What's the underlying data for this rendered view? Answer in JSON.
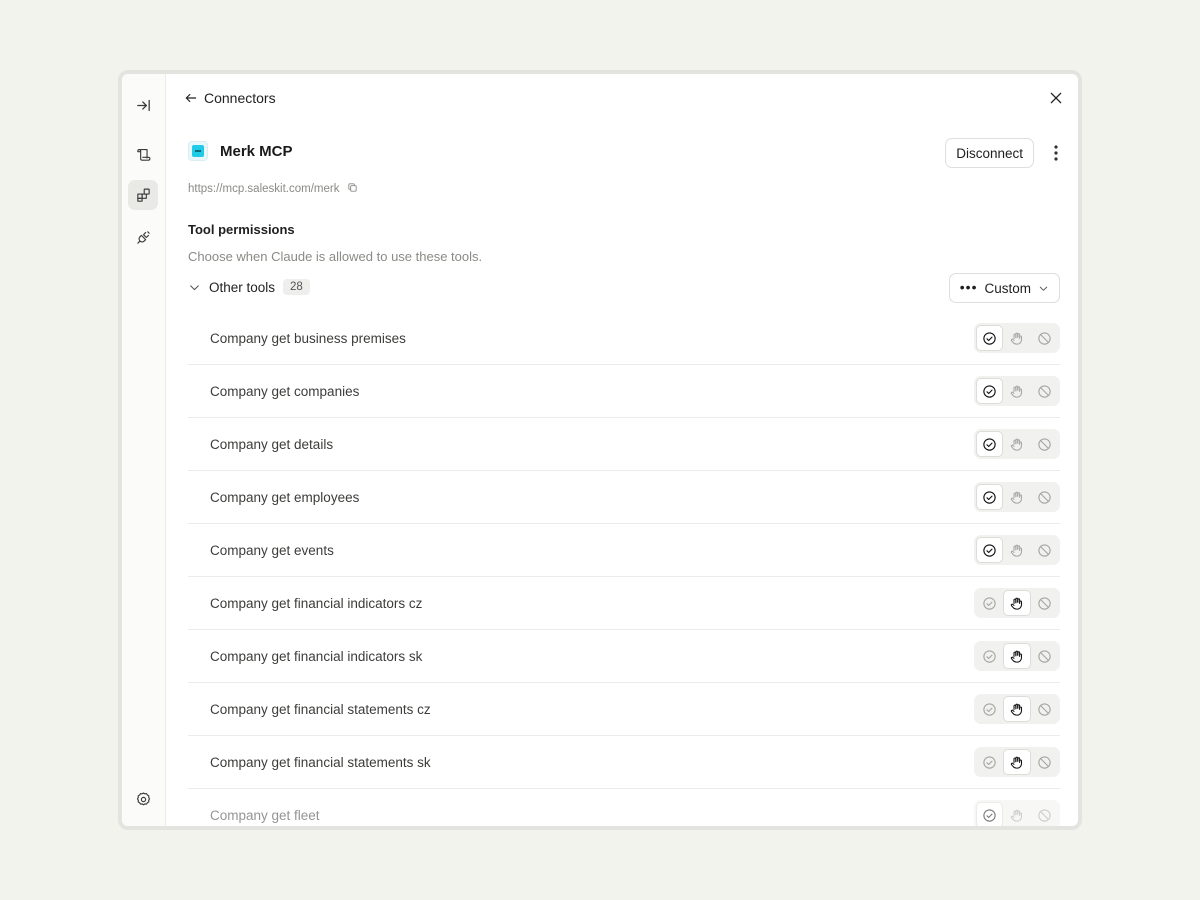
{
  "nav": {
    "back_label": "Connectors"
  },
  "connector": {
    "name": "Merk MCP",
    "url": "https://mcp.saleskit.com/merk",
    "disconnect_label": "Disconnect",
    "logo_color": "#1fcbe6"
  },
  "permissions": {
    "title": "Tool permissions",
    "subtitle": "Choose when Claude is allowed to use these tools.",
    "group_label": "Other tools",
    "group_count": "28",
    "mode_label": "Custom"
  },
  "tools": [
    {
      "name": "Company get business premises",
      "permission": "allow"
    },
    {
      "name": "Company get companies",
      "permission": "allow"
    },
    {
      "name": "Company get details",
      "permission": "allow"
    },
    {
      "name": "Company get employees",
      "permission": "allow"
    },
    {
      "name": "Company get events",
      "permission": "allow"
    },
    {
      "name": "Company get financial indicators cz",
      "permission": "ask"
    },
    {
      "name": "Company get financial indicators sk",
      "permission": "ask"
    },
    {
      "name": "Company get financial statements cz",
      "permission": "ask"
    },
    {
      "name": "Company get financial statements sk",
      "permission": "ask"
    },
    {
      "name": "Company get fleet",
      "permission": "allow"
    }
  ],
  "icons": {
    "rail": [
      "collapse-sidebar-icon",
      "scroll-icon",
      "connectors-icon",
      "plug-icon",
      "settings-icon"
    ],
    "permission_options": [
      "check-circle-icon",
      "hand-icon",
      "block-icon"
    ]
  }
}
